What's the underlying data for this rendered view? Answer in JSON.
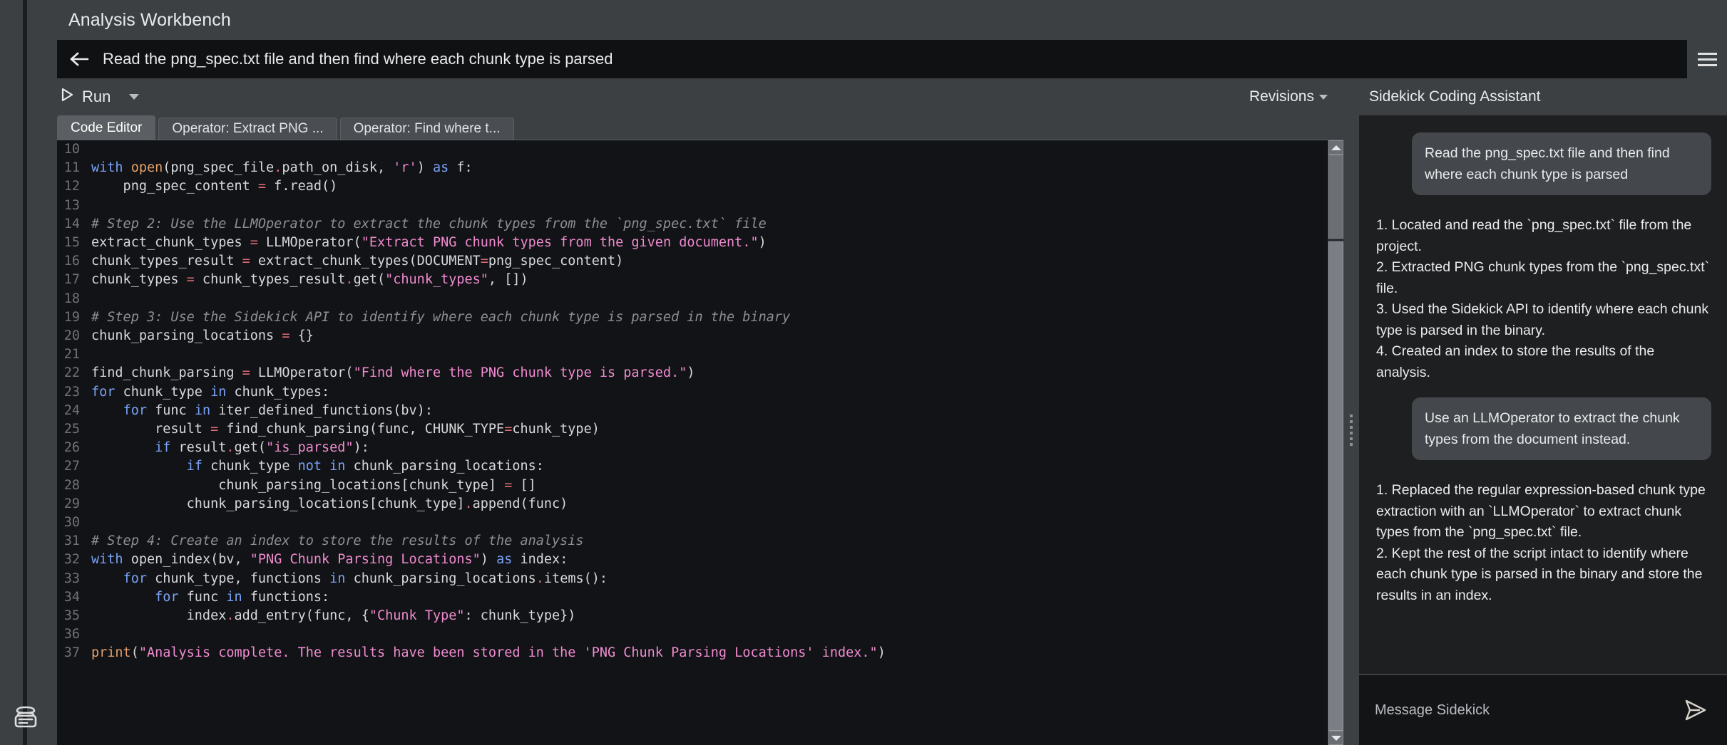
{
  "app": {
    "title": "Analysis Workbench"
  },
  "taskbar": {
    "back_icon": "back-arrow-icon",
    "query": "Read the png_spec.txt file and then find where each chunk type is parsed",
    "menu_icon": "hamburger-menu-icon"
  },
  "toolbar": {
    "run_label": "Run",
    "run_icon": "play-icon",
    "run_caret_icon": "chevron-down-icon",
    "revisions_label": "Revisions",
    "revisions_caret_icon": "chevron-down-icon",
    "assistant_title": "Sidekick Coding Assistant"
  },
  "rail": {
    "db_icon": "database-stack-icon"
  },
  "tabs": [
    {
      "label": "Code Editor",
      "active": true
    },
    {
      "label": "Operator: Extract PNG ...",
      "active": false
    },
    {
      "label": "Operator: Find where t...",
      "active": false
    }
  ],
  "editor": {
    "first_line_number": 10,
    "lines": [
      {
        "n": 10,
        "tokens": []
      },
      {
        "n": 11,
        "tokens": [
          {
            "t": "with ",
            "c": "k"
          },
          {
            "t": "open",
            "c": "fn"
          },
          {
            "t": "(png_spec_file",
            "c": "p"
          },
          {
            "t": ".",
            "c": "op"
          },
          {
            "t": "path_on_disk, ",
            "c": "p"
          },
          {
            "t": "'r'",
            "c": "s"
          },
          {
            "t": ") ",
            "c": "p"
          },
          {
            "t": "as ",
            "c": "k"
          },
          {
            "t": "f:",
            "c": "p"
          }
        ]
      },
      {
        "n": 12,
        "tokens": [
          {
            "t": "    png_spec_content ",
            "c": "p"
          },
          {
            "t": "=",
            "c": "op"
          },
          {
            "t": " f.read()",
            "c": "p"
          }
        ]
      },
      {
        "n": 13,
        "tokens": []
      },
      {
        "n": 14,
        "tokens": [
          {
            "t": "# Step 2: Use the LLMOperator to extract the chunk types from the `png_spec.txt` file",
            "c": "c"
          }
        ]
      },
      {
        "n": 15,
        "tokens": [
          {
            "t": "extract_chunk_types ",
            "c": "p"
          },
          {
            "t": "=",
            "c": "op"
          },
          {
            "t": " LLMOperator(",
            "c": "p"
          },
          {
            "t": "\"Extract PNG chunk types from the given document.\"",
            "c": "s"
          },
          {
            "t": ")",
            "c": "p"
          }
        ]
      },
      {
        "n": 16,
        "tokens": [
          {
            "t": "chunk_types_result ",
            "c": "p"
          },
          {
            "t": "=",
            "c": "op"
          },
          {
            "t": " extract_chunk_types(DOCUMENT",
            "c": "p"
          },
          {
            "t": "=",
            "c": "op"
          },
          {
            "t": "png_spec_content)",
            "c": "p"
          }
        ]
      },
      {
        "n": 17,
        "tokens": [
          {
            "t": "chunk_types ",
            "c": "p"
          },
          {
            "t": "=",
            "c": "op"
          },
          {
            "t": " chunk_types_result",
            "c": "p"
          },
          {
            "t": ".",
            "c": "op"
          },
          {
            "t": "get(",
            "c": "p"
          },
          {
            "t": "\"chunk_types\"",
            "c": "s"
          },
          {
            "t": ", [])",
            "c": "p"
          }
        ]
      },
      {
        "n": 18,
        "tokens": []
      },
      {
        "n": 19,
        "tokens": [
          {
            "t": "# Step 3: Use the Sidekick API to identify where each chunk type is parsed in the binary",
            "c": "c"
          }
        ]
      },
      {
        "n": 20,
        "tokens": [
          {
            "t": "chunk_parsing_locations ",
            "c": "p"
          },
          {
            "t": "=",
            "c": "op"
          },
          {
            "t": " {}",
            "c": "p"
          }
        ]
      },
      {
        "n": 21,
        "tokens": []
      },
      {
        "n": 22,
        "tokens": [
          {
            "t": "find_chunk_parsing ",
            "c": "p"
          },
          {
            "t": "=",
            "c": "op"
          },
          {
            "t": " LLMOperator(",
            "c": "p"
          },
          {
            "t": "\"Find where the PNG chunk type is parsed.\"",
            "c": "s"
          },
          {
            "t": ")",
            "c": "p"
          }
        ]
      },
      {
        "n": 23,
        "tokens": [
          {
            "t": "for ",
            "c": "k"
          },
          {
            "t": "chunk_type ",
            "c": "p"
          },
          {
            "t": "in ",
            "c": "k"
          },
          {
            "t": "chunk_types:",
            "c": "p"
          }
        ]
      },
      {
        "n": 24,
        "tokens": [
          {
            "t": "    ",
            "c": "p"
          },
          {
            "t": "for ",
            "c": "k"
          },
          {
            "t": "func ",
            "c": "p"
          },
          {
            "t": "in ",
            "c": "k"
          },
          {
            "t": "iter_defined_functions(bv):",
            "c": "p"
          }
        ]
      },
      {
        "n": 25,
        "tokens": [
          {
            "t": "        result ",
            "c": "p"
          },
          {
            "t": "=",
            "c": "op"
          },
          {
            "t": " find_chunk_parsing(func, CHUNK_TYPE",
            "c": "p"
          },
          {
            "t": "=",
            "c": "op"
          },
          {
            "t": "chunk_type)",
            "c": "p"
          }
        ]
      },
      {
        "n": 26,
        "tokens": [
          {
            "t": "        ",
            "c": "p"
          },
          {
            "t": "if ",
            "c": "k"
          },
          {
            "t": "result",
            "c": "p"
          },
          {
            "t": ".",
            "c": "op"
          },
          {
            "t": "get(",
            "c": "p"
          },
          {
            "t": "\"is_parsed\"",
            "c": "s"
          },
          {
            "t": "):",
            "c": "p"
          }
        ]
      },
      {
        "n": 27,
        "tokens": [
          {
            "t": "            ",
            "c": "p"
          },
          {
            "t": "if ",
            "c": "k"
          },
          {
            "t": "chunk_type ",
            "c": "p"
          },
          {
            "t": "not in ",
            "c": "k"
          },
          {
            "t": "chunk_parsing_locations:",
            "c": "p"
          }
        ]
      },
      {
        "n": 28,
        "tokens": [
          {
            "t": "                chunk_parsing_locations[chunk_type] ",
            "c": "p"
          },
          {
            "t": "=",
            "c": "op"
          },
          {
            "t": " []",
            "c": "p"
          }
        ]
      },
      {
        "n": 29,
        "tokens": [
          {
            "t": "            chunk_parsing_locations[chunk_type]",
            "c": "p"
          },
          {
            "t": ".",
            "c": "op"
          },
          {
            "t": "append(func)",
            "c": "p"
          }
        ]
      },
      {
        "n": 30,
        "tokens": []
      },
      {
        "n": 31,
        "tokens": [
          {
            "t": "# Step 4: Create an index to store the results of the analysis",
            "c": "c"
          }
        ]
      },
      {
        "n": 32,
        "tokens": [
          {
            "t": "with ",
            "c": "k"
          },
          {
            "t": "open_index(bv, ",
            "c": "p"
          },
          {
            "t": "\"PNG Chunk Parsing Locations\"",
            "c": "s"
          },
          {
            "t": ") ",
            "c": "p"
          },
          {
            "t": "as ",
            "c": "k"
          },
          {
            "t": "index:",
            "c": "p"
          }
        ]
      },
      {
        "n": 33,
        "tokens": [
          {
            "t": "    ",
            "c": "p"
          },
          {
            "t": "for ",
            "c": "k"
          },
          {
            "t": "chunk_type, functions ",
            "c": "p"
          },
          {
            "t": "in ",
            "c": "k"
          },
          {
            "t": "chunk_parsing_locations",
            "c": "p"
          },
          {
            "t": ".",
            "c": "op"
          },
          {
            "t": "items():",
            "c": "p"
          }
        ]
      },
      {
        "n": 34,
        "tokens": [
          {
            "t": "        ",
            "c": "p"
          },
          {
            "t": "for ",
            "c": "k"
          },
          {
            "t": "func ",
            "c": "p"
          },
          {
            "t": "in ",
            "c": "k"
          },
          {
            "t": "functions:",
            "c": "p"
          }
        ]
      },
      {
        "n": 35,
        "tokens": [
          {
            "t": "            index",
            "c": "p"
          },
          {
            "t": ".",
            "c": "op"
          },
          {
            "t": "add_entry(func, {",
            "c": "p"
          },
          {
            "t": "\"Chunk Type\"",
            "c": "s"
          },
          {
            "t": ": chunk_type})",
            "c": "p"
          }
        ]
      },
      {
        "n": 36,
        "tokens": []
      },
      {
        "n": 37,
        "tokens": [
          {
            "t": "print",
            "c": "fn"
          },
          {
            "t": "(",
            "c": "p"
          },
          {
            "t": "\"Analysis complete. The results have been stored in the 'PNG Chunk Parsing Locations' index.\"",
            "c": "s"
          },
          {
            "t": ")",
            "c": "p"
          }
        ]
      }
    ]
  },
  "chat": {
    "messages": [
      {
        "role": "user",
        "text": "Read the png_spec.txt file and then find where each chunk type is parsed"
      },
      {
        "role": "assistant",
        "lines": [
          "1. Located and read the `png_spec.txt` file from the project.",
          "2. Extracted PNG chunk types from the `png_spec.txt` file.",
          "3. Used the Sidekick API to identify where each chunk type is parsed in the binary.",
          "4. Created an index to store the results of the analysis."
        ]
      },
      {
        "role": "user",
        "text": "Use an LLMOperator to extract the chunk types from the document instead."
      },
      {
        "role": "assistant",
        "lines": [
          "1. Replaced the regular expression-based chunk type extraction with an `LLMOperator` to extract chunk types from the `png_spec.txt` file.",
          "2. Kept the rest of the script intact to identify where each chunk type is parsed in the binary and store the results in an index."
        ]
      }
    ],
    "input_placeholder": "Message Sidekick",
    "send_icon": "send-paper-plane-icon"
  },
  "scrollbar": {
    "up_icon": "scroll-up-arrow-icon",
    "down_icon": "scroll-down-arrow-icon",
    "splitter_icon": "splitter-grip-icon"
  },
  "colors": {
    "window_bg": "#3c4043",
    "editor_bg": "#121316",
    "chat_bg": "#1e1f21",
    "keyword": "#7aa2f7",
    "string": "#f08bd0",
    "comment": "#8b8f94",
    "builtin": "#e6a06a",
    "operator": "#e06c75",
    "text": "#e8eaed"
  }
}
